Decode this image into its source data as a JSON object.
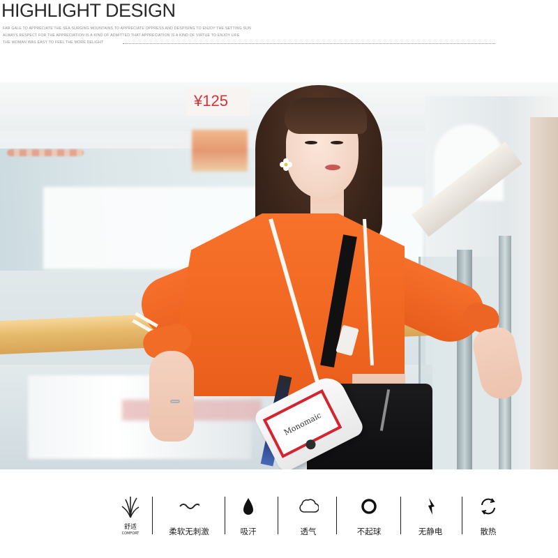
{
  "header": {
    "title": "HIGHLIGHT DESIGN",
    "description_lines": [
      "FAR GALE TO APPRECIATE THE SEA SURGING MOUNTAINS TO APPRECIATE OPPRESS AND DESPISING TO ENJOY THE SETTING SUN",
      "ALWAYS RESPECT FOR THE APPRECIATION IS A KIND OF ADMITTED THAT APPRECIATION IS A KIND OF VIRTUE TO ENJOY LIFE",
      "THE WOMAN WAS EASY TO FEEL THE MORE DELIGHT"
    ]
  },
  "photo": {
    "background_sign": "¥125",
    "bag_text": "Monomaic"
  },
  "features": [
    {
      "icon": "grass-icon",
      "label": "舒适",
      "sublabel": "COMFORT"
    },
    {
      "icon": "wave-icon",
      "label": "柔软无刺激"
    },
    {
      "icon": "drop-icon",
      "label": "吸汗"
    },
    {
      "icon": "cloud-icon",
      "label": "透气"
    },
    {
      "icon": "ring-icon",
      "label": "不起球"
    },
    {
      "icon": "lightning-icon",
      "label": "无静电"
    },
    {
      "icon": "refresh-icon",
      "label": "散热"
    }
  ],
  "colors": {
    "jacket": "#f26a24",
    "bag_accent": "#d32430",
    "text": "#222222"
  }
}
